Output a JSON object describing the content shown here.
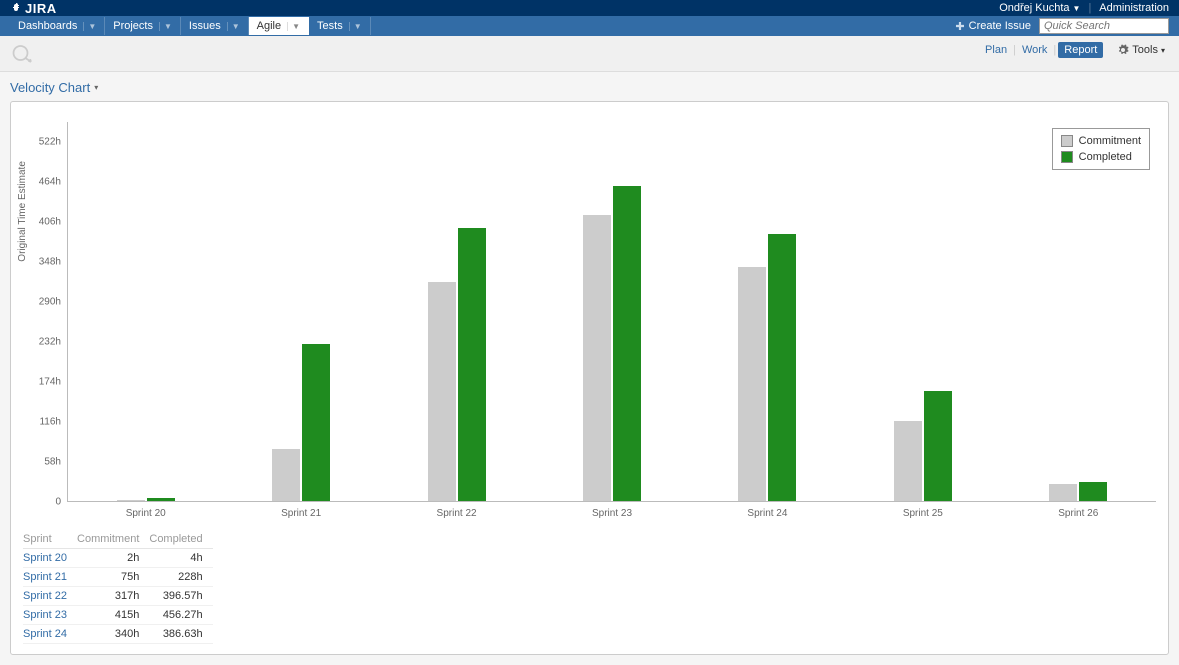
{
  "topbar": {
    "product": "JIRA",
    "user": "Ondřej Kuchta",
    "admin": "Administration"
  },
  "nav": {
    "items": [
      {
        "label": "Dashboards",
        "active": false
      },
      {
        "label": "Projects",
        "active": false
      },
      {
        "label": "Issues",
        "active": false
      },
      {
        "label": "Agile",
        "active": true
      },
      {
        "label": "Tests",
        "active": false
      }
    ],
    "create": "Create Issue",
    "search_placeholder": "Quick Search"
  },
  "views": {
    "plan": "Plan",
    "work": "Work",
    "report": "Report",
    "tools": "Tools"
  },
  "chart_selector": "Velocity Chart",
  "chart_data": {
    "type": "bar",
    "title": "",
    "ylabel": "Original Time Estimate",
    "xlabel": "",
    "ylim": [
      0,
      522
    ],
    "yticks": [
      0,
      58,
      116,
      174,
      232,
      290,
      348,
      406,
      464,
      522
    ],
    "ytick_labels": [
      "0",
      "58h",
      "116h",
      "174h",
      "232h",
      "290h",
      "348h",
      "406h",
      "464h",
      "522h"
    ],
    "categories": [
      "Sprint 20",
      "Sprint 21",
      "Sprint 22",
      "Sprint 23",
      "Sprint 24",
      "Sprint 25",
      "Sprint 26"
    ],
    "series": [
      {
        "name": "Commitment",
        "color": "#cccccc",
        "values": [
          2,
          75,
          317,
          415,
          340,
          116,
          24
        ]
      },
      {
        "name": "Completed",
        "color": "#1f8b1f",
        "values": [
          4,
          228,
          396.57,
          456.27,
          386.63,
          160,
          28
        ]
      }
    ],
    "legend": [
      "Commitment",
      "Completed"
    ]
  },
  "table": {
    "headers": [
      "Sprint",
      "Commitment",
      "Completed"
    ],
    "rows": [
      {
        "sprint": "Sprint 20",
        "commitment": "2h",
        "completed": "4h"
      },
      {
        "sprint": "Sprint 21",
        "commitment": "75h",
        "completed": "228h"
      },
      {
        "sprint": "Sprint 22",
        "commitment": "317h",
        "completed": "396.57h"
      },
      {
        "sprint": "Sprint 23",
        "commitment": "415h",
        "completed": "456.27h"
      },
      {
        "sprint": "Sprint 24",
        "commitment": "340h",
        "completed": "386.63h"
      }
    ]
  }
}
